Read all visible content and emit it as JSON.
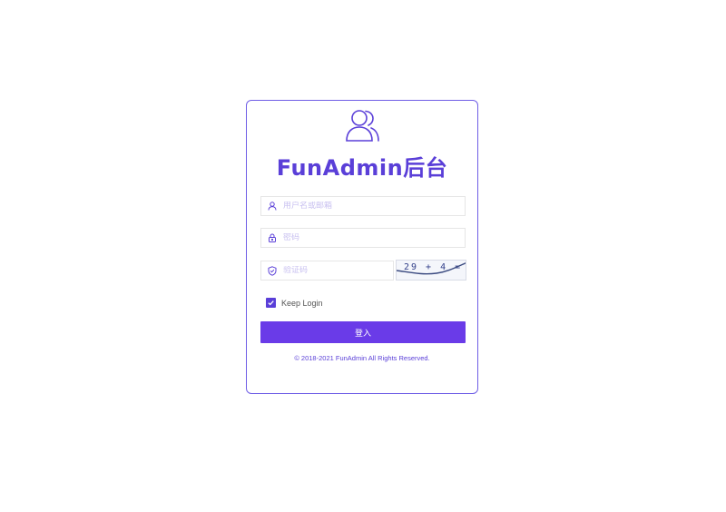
{
  "app": {
    "title": "FunAdmin后台",
    "accent_color": "#5a3fd8",
    "button_color": "#6a3be8",
    "logo_icon": "users-icon"
  },
  "form": {
    "username": {
      "placeholder": "用户名或邮箱",
      "value": "",
      "icon": "user-icon"
    },
    "password": {
      "placeholder": "密码",
      "value": "",
      "icon": "lock-icon"
    },
    "captcha": {
      "placeholder": "验证码",
      "value": "",
      "icon": "shield-check-icon",
      "image_text": "29 + 4 ="
    },
    "keep_login": {
      "label": "Keep Login",
      "checked": true
    },
    "submit_label": "登入"
  },
  "footer": {
    "copyright": "© 2018-2021 FunAdmin All Rights Reserved."
  }
}
